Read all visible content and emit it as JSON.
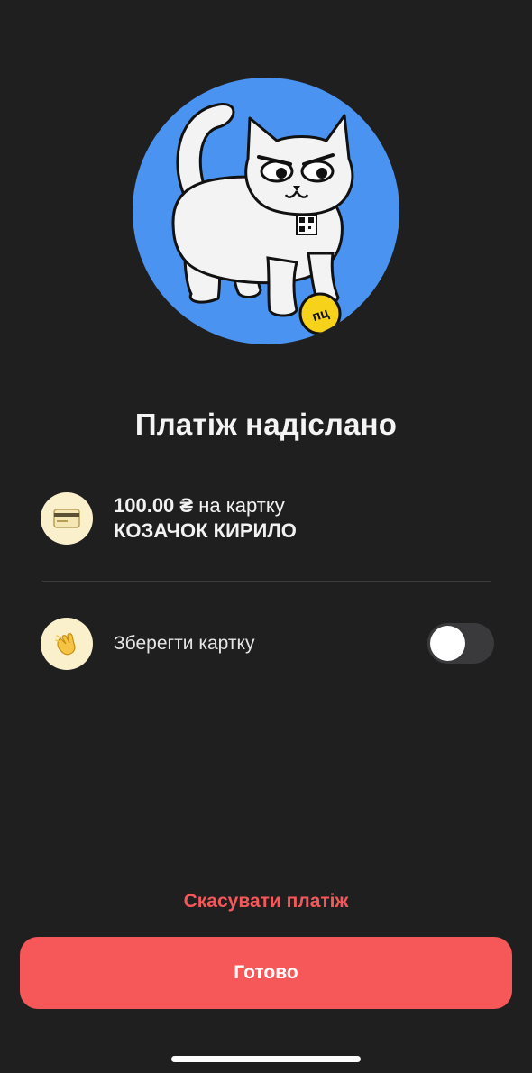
{
  "header": {
    "illustration": "cat-with-qr-collar-and-coin",
    "coin_text": "пц",
    "title": "Платіж надіслано"
  },
  "payment": {
    "icon": "credit-card-icon",
    "amount": "100.00 ₴",
    "amount_suffix": " на картку",
    "recipient": "КОЗАЧОК КИРИЛО"
  },
  "save_card": {
    "icon": "waving-hand-icon",
    "label": "Зберегти картку",
    "enabled": false
  },
  "actions": {
    "cancel_label": "Скасувати платіж",
    "done_label": "Готово"
  },
  "colors": {
    "background": "#1f1f20",
    "accent": "#f6585a",
    "hero": "#4a93f0",
    "icon_bg": "#fbf0cc"
  }
}
